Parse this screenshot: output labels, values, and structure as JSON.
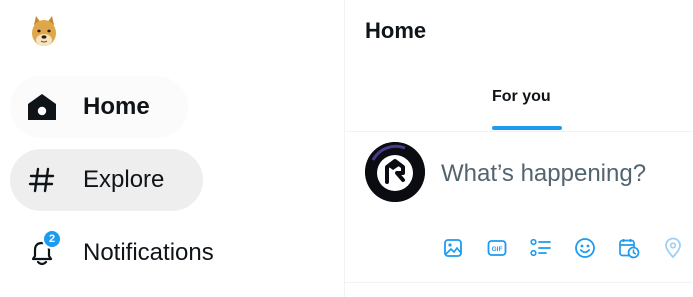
{
  "nav": {
    "logo_icon": "doge-logo-icon",
    "items": [
      {
        "label": "Home",
        "icon": "home-icon",
        "active": true
      },
      {
        "label": "Explore",
        "icon": "hashtag-icon"
      },
      {
        "label": "Notifications",
        "icon": "bell-icon",
        "badge": "2"
      }
    ]
  },
  "main": {
    "title": "Home",
    "tabs": [
      {
        "label": "For you",
        "selected": true
      }
    ],
    "composer": {
      "placeholder": "What’s happening?",
      "avatar_icon": "user-avatar-icon",
      "tools": [
        "media-icon",
        "gif-icon",
        "poll-icon",
        "emoji-icon",
        "schedule-icon",
        "location-icon"
      ]
    }
  },
  "colors": {
    "accent": "#1d9bf0",
    "text": "#0f1419",
    "muted": "#536471",
    "divider": "#eff3f4",
    "hover": "#eeeeee"
  }
}
